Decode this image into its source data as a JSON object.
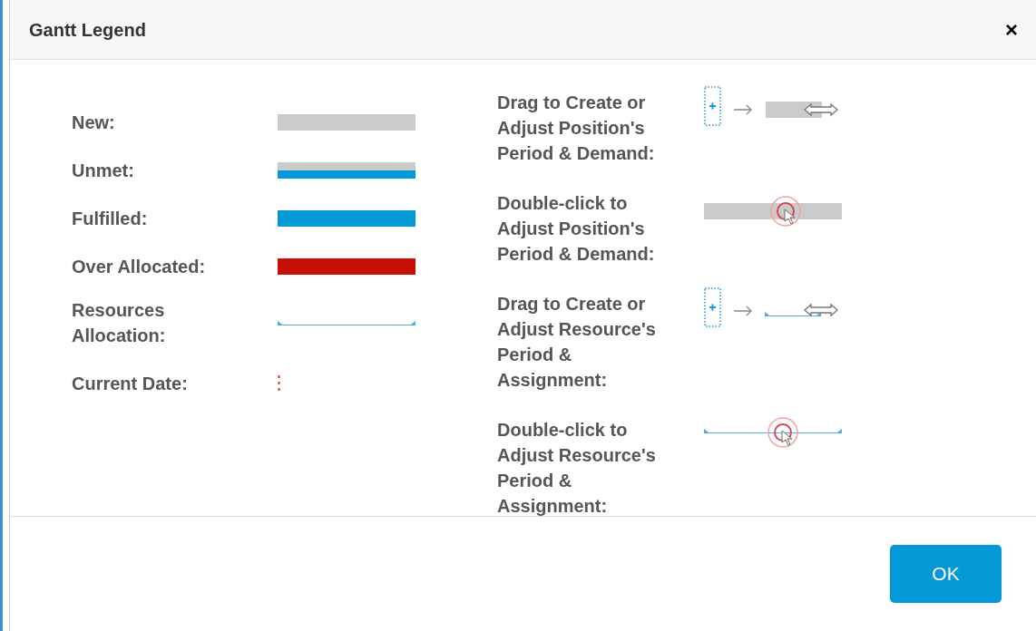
{
  "dialog": {
    "title": "Gantt Legend",
    "close": "×"
  },
  "legend": [
    {
      "kind": "new",
      "label": "New:"
    },
    {
      "kind": "unmet",
      "label": "Unmet:"
    },
    {
      "kind": "fulfilled",
      "label": "Fulfilled:"
    },
    {
      "kind": "over",
      "label": "Over Allocated:"
    },
    {
      "kind": "allocation",
      "label": "Resources Allocation:"
    },
    {
      "kind": "current_date",
      "label": "Current Date:"
    }
  ],
  "actions": [
    {
      "kind": "drag_bar",
      "label": "Drag to Create or Adjust Position's Period & Demand:"
    },
    {
      "kind": "dblclick_bar",
      "label": "Double-click to Adjust Position's Period & Demand:"
    },
    {
      "kind": "drag_allocation",
      "label": "Drag to Create or Adjust Resource's Period & Assignment:"
    },
    {
      "kind": "dblclick_allocation",
      "label": "Double-click to Adjust Resource's Period & Assignment:"
    }
  ],
  "buttons": [
    "OK"
  ]
}
